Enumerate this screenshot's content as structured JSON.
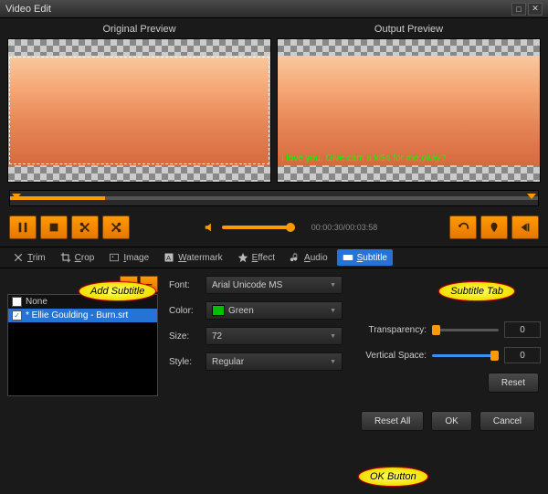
{
  "window": {
    "title": "Video Edit"
  },
  "previews": {
    "left": "Original Preview",
    "right": "Output Preview"
  },
  "subtitle_overlay": "I love you. Give cam a ki$s for me,okay?",
  "timecode": "00:00:30/00:03:58",
  "tabs": {
    "trim": "Trim",
    "crop": "Crop",
    "image": "Image",
    "watermark": "Watermark",
    "effect": "Effect",
    "audio": "Audio",
    "subtitle": "Subtitle"
  },
  "subtitle": {
    "list": {
      "none": "None",
      "selected": "* Ellie Goulding - Burn.srt"
    },
    "font_label": "Font:",
    "font_value": "Arial Unicode MS",
    "color_label": "Color:",
    "color_value": "Green",
    "size_label": "Size:",
    "size_value": "72",
    "style_label": "Style:",
    "style_value": "Regular",
    "transparency_label": "Transparency:",
    "transparency_value": "0",
    "vspace_label": "Vertical Space:",
    "vspace_value": "0",
    "reset": "Reset"
  },
  "footer": {
    "reset_all": "Reset All",
    "ok": "OK",
    "cancel": "Cancel"
  },
  "callouts": {
    "add": "Add Subtitle",
    "tab": "Subtitle Tab",
    "ok": "OK Button"
  }
}
